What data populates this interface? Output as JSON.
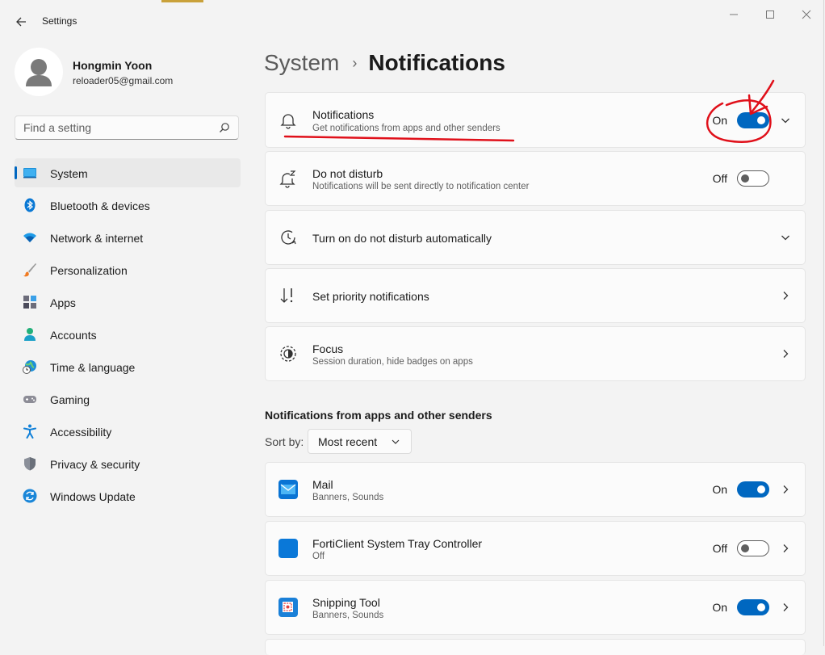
{
  "window": {
    "title": "Settings"
  },
  "profile": {
    "name": "Hongmin Yoon",
    "email": "reloader05@gmail.com"
  },
  "search": {
    "placeholder": "Find a setting"
  },
  "nav": {
    "items": [
      {
        "label": "System",
        "icon": "system-icon",
        "selected": true
      },
      {
        "label": "Bluetooth & devices",
        "icon": "bluetooth-icon"
      },
      {
        "label": "Network & internet",
        "icon": "wifi-icon"
      },
      {
        "label": "Personalization",
        "icon": "brush-icon"
      },
      {
        "label": "Apps",
        "icon": "apps-icon"
      },
      {
        "label": "Accounts",
        "icon": "person-icon"
      },
      {
        "label": "Time & language",
        "icon": "globe-clock-icon"
      },
      {
        "label": "Gaming",
        "icon": "gamepad-icon"
      },
      {
        "label": "Accessibility",
        "icon": "accessibility-icon"
      },
      {
        "label": "Privacy & security",
        "icon": "shield-icon"
      },
      {
        "label": "Windows Update",
        "icon": "update-icon"
      }
    ]
  },
  "breadcrumb": {
    "parent": "System",
    "separator": "›",
    "current": "Notifications"
  },
  "settings": {
    "notifications": {
      "title": "Notifications",
      "subtitle": "Get notifications from apps and other senders",
      "state": "On",
      "icon": "bell-icon"
    },
    "dnd": {
      "title": "Do not disturb",
      "subtitle": "Notifications will be sent directly to notification center",
      "state": "Off",
      "icon": "bell-zz-icon"
    },
    "dnd_auto": {
      "title": "Turn on do not disturb automatically",
      "icon": "clock-icon"
    },
    "priority": {
      "title": "Set priority notifications",
      "icon": "priority-sort-icon"
    },
    "focus": {
      "title": "Focus",
      "subtitle": "Session duration, hide badges on apps",
      "icon": "focus-icon"
    }
  },
  "apps_section": {
    "title": "Notifications from apps and other senders",
    "sort_label": "Sort by:",
    "sort_value": "Most recent",
    "apps": [
      {
        "name": "Mail",
        "subtitle": "Banners, Sounds",
        "state": "On",
        "icon": "mail-icon"
      },
      {
        "name": "FortiClient System Tray Controller",
        "subtitle": "Off",
        "state": "Off",
        "icon": "forticlient-icon"
      },
      {
        "name": "Snipping Tool",
        "subtitle": "Banners, Sounds",
        "state": "On",
        "icon": "snipping-tool-icon"
      }
    ]
  },
  "colors": {
    "accent": "#0067c0",
    "annotation": "#e0101a"
  }
}
